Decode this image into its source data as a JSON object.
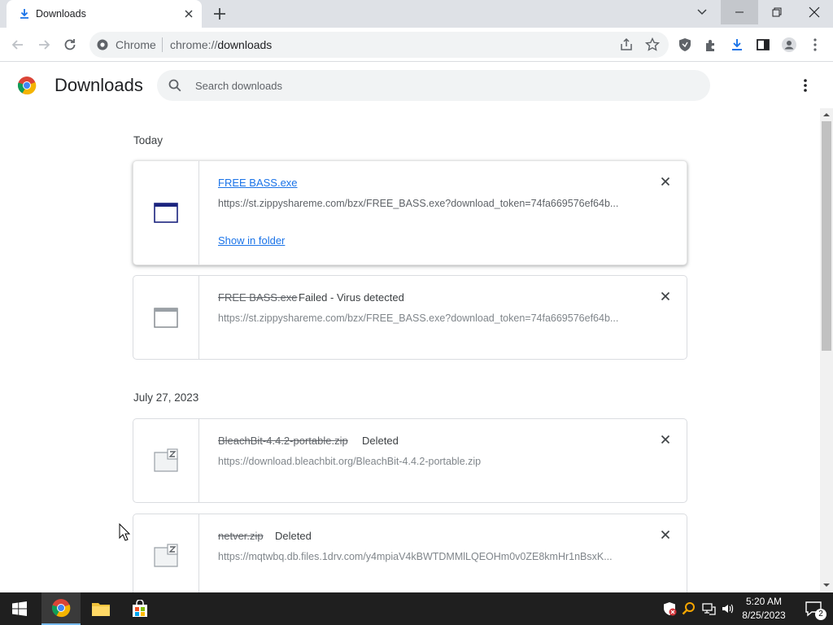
{
  "tab": {
    "title": "Downloads"
  },
  "omnibox": {
    "site": "Chrome",
    "scheme": "chrome://",
    "path": "downloads"
  },
  "header": {
    "title": "Downloads",
    "search_placeholder": "Search downloads"
  },
  "sections": [
    {
      "date": "Today"
    },
    {
      "date": "July 27, 2023"
    }
  ],
  "downloads": [
    {
      "name": "FREE BASS.exe",
      "status": "",
      "url": "https://st.zippyshareme.com/bzx/FREE_BASS.exe?download_token=74fa669576ef64b...",
      "action": "Show in folder",
      "icon": "window-icon"
    },
    {
      "name": "FREE BASS.exe",
      "status": "Failed - Virus detected",
      "url": "https://st.zippyshareme.com/bzx/FREE_BASS.exe?download_token=74fa669576ef64b...",
      "icon": "window-icon"
    },
    {
      "name": "BleachBit-4.4.2-portable.zip",
      "status": "Deleted",
      "url": "https://download.bleachbit.org/BleachBit-4.4.2-portable.zip",
      "icon": "zip-file-icon"
    },
    {
      "name": "netver.zip",
      "status": "Deleted",
      "url": "https://mqtwbq.db.files.1drv.com/y4mpiaV4kBWTDMMlLQEOHm0v0ZE8kmHr1nBsxK...",
      "icon": "zip-file-icon"
    }
  ],
  "taskbar": {
    "time": "5:20 AM",
    "date": "8/25/2023",
    "notifications": "2"
  },
  "colors": {
    "accent": "#1a73e8",
    "tabstrip": "#dee1e6",
    "taskbar": "#1f1f1f"
  }
}
